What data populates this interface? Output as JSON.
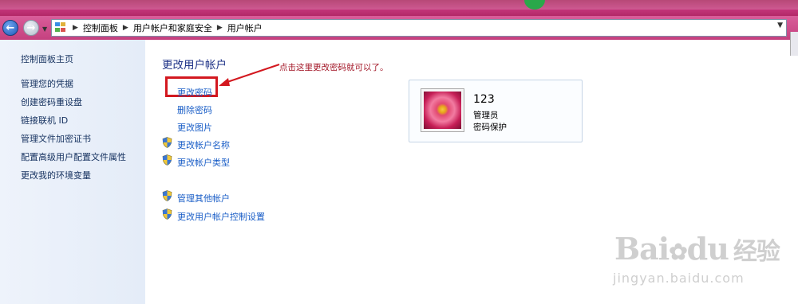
{
  "address": {
    "crumbs": [
      "控制面板",
      "用户帐户和家庭安全",
      "用户帐户"
    ]
  },
  "sidebar": {
    "home": "控制面板主页",
    "links": [
      "管理您的凭据",
      "创建密码重设盘",
      "链接联机 ID",
      "管理文件加密证书",
      "配置高级用户配置文件属性",
      "更改我的环境变量"
    ]
  },
  "main": {
    "title": "更改用户帐户",
    "tasks": [
      "更改密码",
      "删除密码",
      "更改图片",
      "更改帐户名称",
      "更改帐户类型"
    ],
    "other_tasks": [
      "管理其他帐户",
      "更改用户帐户控制设置"
    ]
  },
  "annotation": "点击这里更改密码就可以了。",
  "account": {
    "name": "123",
    "role": "管理员",
    "status": "密码保护"
  },
  "watermark": {
    "brand_left": "Bai",
    "brand_mid": "du",
    "brand_right": "经验",
    "url": "jingyan.baidu.com"
  },
  "colors": {
    "titlebar": "#b22867",
    "highlight": "#d3181f",
    "link": "#1a5ec7",
    "heading": "#1e3287"
  }
}
